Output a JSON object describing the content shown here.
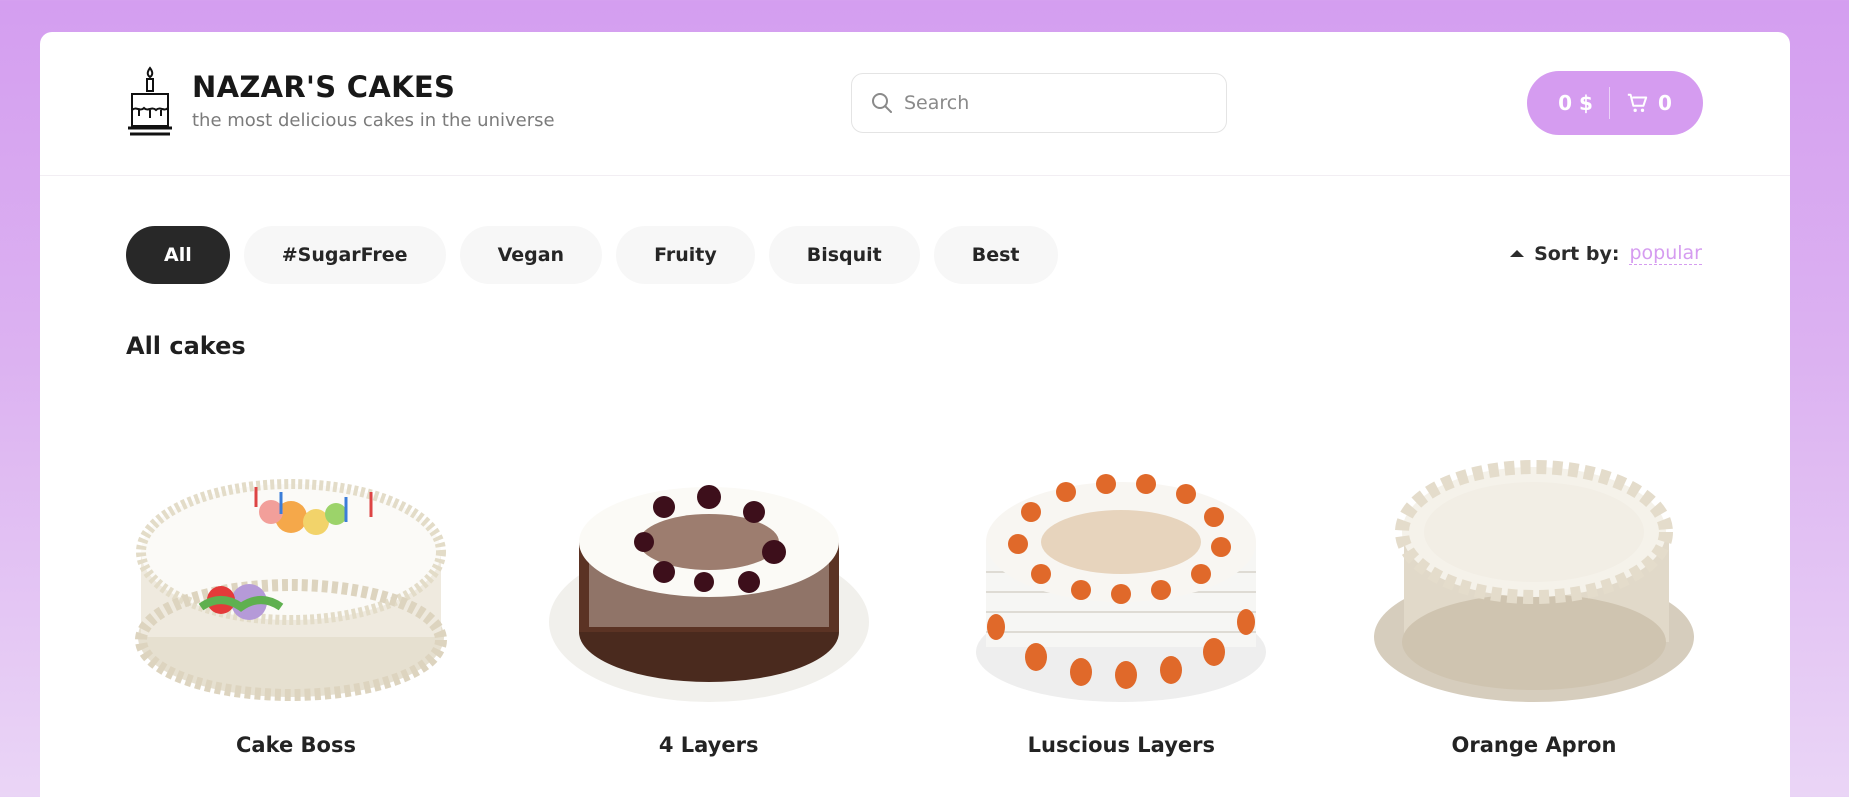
{
  "brand": {
    "title": "NAZAR'S CAKES",
    "subtitle": "the most delicious cakes in the universe",
    "icon": "cake-logo-icon"
  },
  "search": {
    "placeholder": "Search",
    "value": ""
  },
  "cart": {
    "price": "0 $",
    "count": "0"
  },
  "categories": [
    "All",
    "#SugarFree",
    "Vegan",
    "Fruity",
    "Bisquit",
    "Best"
  ],
  "active_category": "All",
  "sort": {
    "label": "Sort by:",
    "value": "popular"
  },
  "section_title": "All cakes",
  "products": [
    {
      "name": "Cake Boss"
    },
    {
      "name": "4 Layers"
    },
    {
      "name": "Luscious Layers"
    },
    {
      "name": "Orange Apron"
    }
  ],
  "colors": {
    "accent": "#d59cf0",
    "active_chip": "#282828",
    "background_top": "#d49ef0"
  }
}
